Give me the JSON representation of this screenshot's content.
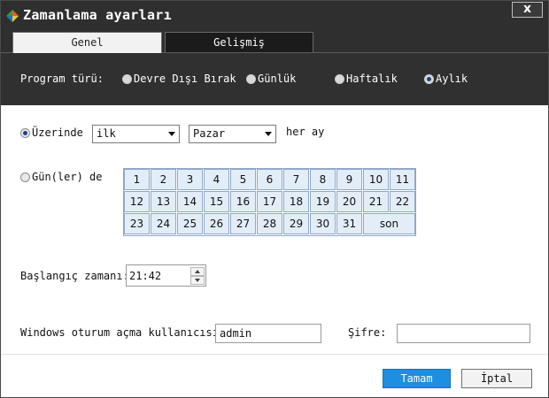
{
  "window": {
    "title": "Zamanlama ayarları",
    "close_label": "x"
  },
  "tabs": [
    {
      "label": "Genel",
      "active": true
    },
    {
      "label": "Gelişmiş",
      "active": false
    }
  ],
  "program_type": {
    "label": "Program türü:",
    "options": [
      {
        "label": "Devre Dışı Bırak",
        "checked": false
      },
      {
        "label": "Günlük",
        "checked": false
      },
      {
        "label": "Haftalık",
        "checked": false
      },
      {
        "label": "Aylık",
        "checked": true
      }
    ]
  },
  "monthly": {
    "on_label": "Üzerinde",
    "on_checked": true,
    "ordinal_value": "ilk",
    "weekday_value": "Pazar",
    "suffix": "her ay",
    "days_label": "Gün(ler) de",
    "days_checked": false,
    "days": [
      "1",
      "2",
      "3",
      "4",
      "5",
      "6",
      "7",
      "8",
      "9",
      "10",
      "11",
      "12",
      "13",
      "14",
      "15",
      "16",
      "17",
      "18",
      "19",
      "20",
      "21",
      "22",
      "23",
      "24",
      "25",
      "26",
      "27",
      "28",
      "29",
      "30",
      "31",
      "son"
    ]
  },
  "start_time": {
    "label": "Başlangıç zamanı:",
    "value": "21:42"
  },
  "credentials": {
    "user_label": "Windows oturum açma kullanıcısı:",
    "user_value": "admin",
    "password_label": "Şifre:",
    "password_value": ""
  },
  "buttons": {
    "ok": "Tamam",
    "cancel": "İptal"
  },
  "colors": {
    "titlebar": "#2f2f2f",
    "accent": "#1d8fe0",
    "day_cell": "#e3edf8"
  }
}
